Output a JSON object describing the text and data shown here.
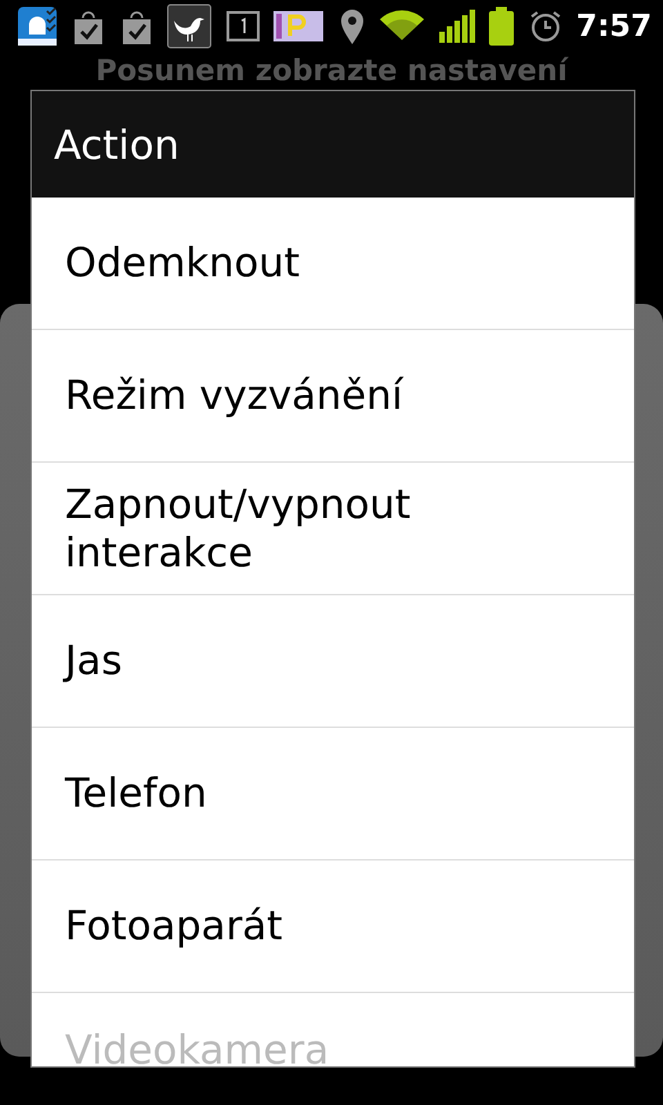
{
  "status_bar": {
    "time": "7:57"
  },
  "background": {
    "title": "Posunem zobrazte nastavení"
  },
  "dialog": {
    "title": "Action",
    "items": [
      {
        "label": "Odemknout"
      },
      {
        "label": "Režim vyzvánění"
      },
      {
        "label": "Zapnout/vypnout interakce"
      },
      {
        "label": "Jas"
      },
      {
        "label": "Telefon"
      },
      {
        "label": "Fotoaparát"
      },
      {
        "label": "Videokamera"
      }
    ]
  }
}
